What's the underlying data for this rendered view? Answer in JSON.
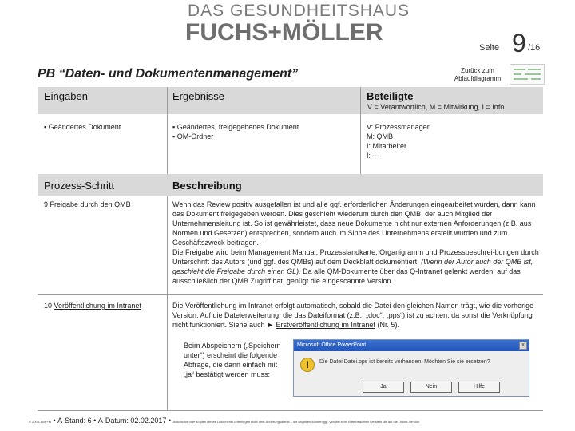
{
  "logo": {
    "line1": "DAS GESUNDHEITSHAUS",
    "line2": "FUCHS+MÖLLER"
  },
  "page": {
    "label": "Seite",
    "number": "9",
    "total": "/16"
  },
  "back_link": "Zurück zum Ablaufdiagramm",
  "title": "PB “Daten- und Dokumentenmanagement”",
  "header_row": {
    "eingaben": "Eingaben",
    "ergebnisse": "Ergebnisse",
    "beteiligte": "Beteiligte",
    "legend": "V = Verantwortlich, M = Mitwirkung, I = Info"
  },
  "inputs": [
    "Geändertes Dokument"
  ],
  "results": [
    "Geändertes, freigegebenes Dokument",
    "QM-Ordner"
  ],
  "participants": [
    "V: Prozessmanager",
    "M: QMB",
    "I: Mitarbeiter",
    "I: ---"
  ],
  "step_header": {
    "prozess": "Prozess-Schritt",
    "beschreibung": "Beschreibung"
  },
  "steps": [
    {
      "number": "9",
      "name": "Freigabe durch den QMB",
      "text1": "Wenn das Review positiv ausgefallen ist und alle ggf. erforderlichen Änderungen eingearbeitet wurden, dann kann das Dokument freigegeben werden. Dies geschieht wiederum durch den QMB, der auch Mitglied der Unternehmensleitung ist. So ist gewährleistet, dass neue Dokumente nicht nur externen Anforderungen (z.B. aus Normen und Gesetzen) entsprechen, sondern auch im Sinne des Unternehmens erstellt wurden und zum Geschäftszweck beitragen.",
      "text2a": "Die Freigabe wird beim Management Manual, Prozesslandkarte, Organigramm und Prozessbeschrei-bungen durch Unterschrift des Autors (und ggf. des QMBs) auf dem Deckblatt dokumentiert.",
      "text2b": "(Wenn der Autor auch der QMB ist, geschieht die Freigabe durch einen GL).",
      "text2c": "Da alle QM-Dokumente über das Q-Intranet gelenkt werden, auf das ausschließlich der QMB Zugriff hat, genügt die eingescannte Version."
    },
    {
      "number": "10",
      "name": "Veröffentlichung im Intranet",
      "text1": "Die Veröffentlichung im Intranet erfolgt automatisch, sobald die Datei den gleichen Namen trägt, wie die vorherige Version. Auf die Dateierweiterung, die das Dateiformat (z.B.: „doc“, „pps“) ist zu achten, da sonst die Verknüpfung nicht funktioniert. Siehe auch",
      "arrow": "►",
      "link": "Erstveröffentlichung im Intranet",
      "link_suffix": "(Nr. 5).",
      "note": "Beim Abspeichern („Speichern unter“) erscheint die folgende Abfrage, die dann einfach mit „ja“ bestätigt werden muss:"
    }
  ],
  "dialog": {
    "title": "Microsoft Office PowerPoint",
    "close": "x",
    "icon": "!",
    "message": "Die Datei Datei.pps ist bereits vorhanden. Möchten Sie sie ersetzen?",
    "yes": "Ja",
    "no": "Nein",
    "help": "Hilfe"
  },
  "footer": {
    "copyright": "© 2008-15/F+M",
    "stand": "• Ä-Stand: 6 • Ä-Datum: 02.02.2017 •",
    "disclaimer": "Ausdrucke oder Kopien dieses Dokuments unterliegen nicht dem Änderungsdienst – die Angaben können ggf. veraltet sein! Bitte beachten Sie stets die auf die Online-Version."
  }
}
